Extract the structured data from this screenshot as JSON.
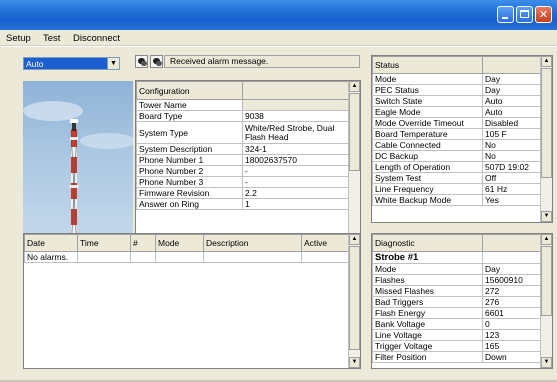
{
  "menu": {
    "items": [
      "Setup",
      "Test",
      "Disconnect"
    ]
  },
  "toolbar": {
    "mode_value": "Auto",
    "message": "Received alarm message.",
    "icons": [
      "alarm-icon",
      "silence-icon"
    ]
  },
  "config": {
    "title": "Configuration",
    "rows": [
      {
        "label": "Tower Name",
        "value": ""
      },
      {
        "label": "Board Type",
        "value": "9038"
      },
      {
        "label": "System Type",
        "value": "White/Red Strobe, Dual Flash Head"
      },
      {
        "label": "System Description",
        "value": "324-1"
      },
      {
        "label": "Phone Number 1",
        "value": "18002637570"
      },
      {
        "label": "Phone Number 2",
        "value": "-"
      },
      {
        "label": "Phone Number 3",
        "value": "-"
      },
      {
        "label": "Firmware Revision",
        "value": "2.2"
      },
      {
        "label": "Answer on Ring",
        "value": "1"
      }
    ]
  },
  "status": {
    "title": "Status",
    "rows": [
      {
        "label": "Mode",
        "value": "Day"
      },
      {
        "label": "PEC Status",
        "value": "Day"
      },
      {
        "label": "Switch State",
        "value": "Auto"
      },
      {
        "label": "Eagle Mode",
        "value": "Auto"
      },
      {
        "label": "Mode Override Timeout",
        "value": "Disabled"
      },
      {
        "label": "Board Temperature",
        "value": "105 F"
      },
      {
        "label": "Cable Connected",
        "value": "No"
      },
      {
        "label": "DC Backup",
        "value": "No"
      },
      {
        "label": "Length of Operation",
        "value": "507D 19:02"
      },
      {
        "label": "System Test",
        "value": "Off"
      },
      {
        "label": "Line Frequency",
        "value": "61 Hz"
      },
      {
        "label": "White Backup Mode",
        "value": "Yes"
      }
    ]
  },
  "alarms": {
    "columns": [
      "Date",
      "Time",
      "#",
      "Mode",
      "Description",
      "Active"
    ],
    "empty_text": "No alarms."
  },
  "diagnostic": {
    "title": "Diagnostic",
    "section": "Strobe #1",
    "rows": [
      {
        "label": "Mode",
        "value": "Day"
      },
      {
        "label": "Flashes",
        "value": "15600910"
      },
      {
        "label": "Missed Flashes",
        "value": "272"
      },
      {
        "label": "Bad Triggers",
        "value": "276"
      },
      {
        "label": "Flash Energy",
        "value": "6601"
      },
      {
        "label": "Bank Voltage",
        "value": "0"
      },
      {
        "label": "Line Voltage",
        "value": "123"
      },
      {
        "label": "Trigger Voltage",
        "value": "165"
      },
      {
        "label": "Filter Position",
        "value": "Down"
      }
    ]
  }
}
